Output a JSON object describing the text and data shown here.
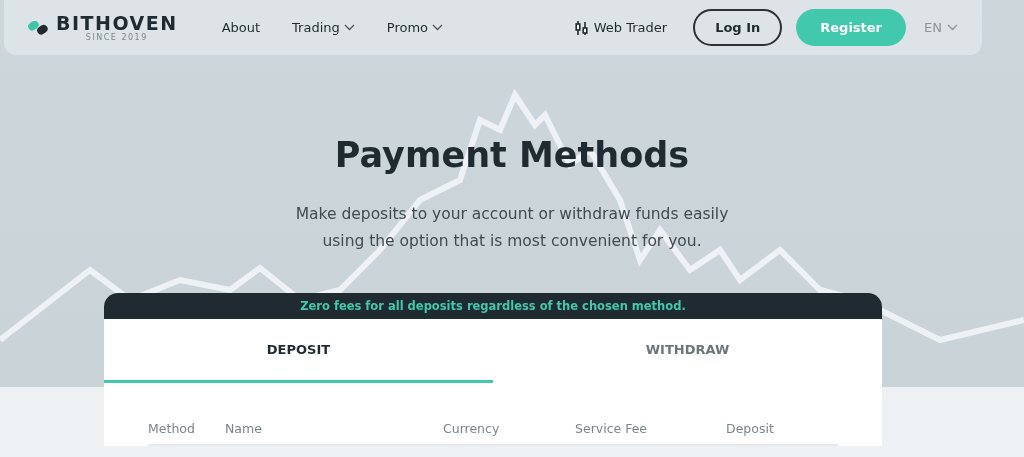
{
  "header": {
    "logo": {
      "name": "BITHOVEN",
      "tagline": "SINCE 2019"
    },
    "nav": [
      {
        "label": "About",
        "dropdown": false
      },
      {
        "label": "Trading",
        "dropdown": true
      },
      {
        "label": "Promo",
        "dropdown": true
      }
    ],
    "web_trader": "Web Trader",
    "login": "Log In",
    "register": "Register",
    "language": "EN"
  },
  "hero": {
    "title": "Payment Methods",
    "subtitle": [
      "Make deposits to your account or withdraw funds easily",
      "using the option that is most convenient for you."
    ]
  },
  "panel": {
    "notice": "Zero fees for all deposits regardless of the chosen method.",
    "tabs": [
      {
        "label": "DEPOSIT",
        "selected": true
      },
      {
        "label": "WITHDRAW",
        "selected": false
      }
    ],
    "table": {
      "columns": [
        "Method",
        "Name",
        "Currency",
        "Service Fee",
        "Deposit"
      ]
    }
  }
}
